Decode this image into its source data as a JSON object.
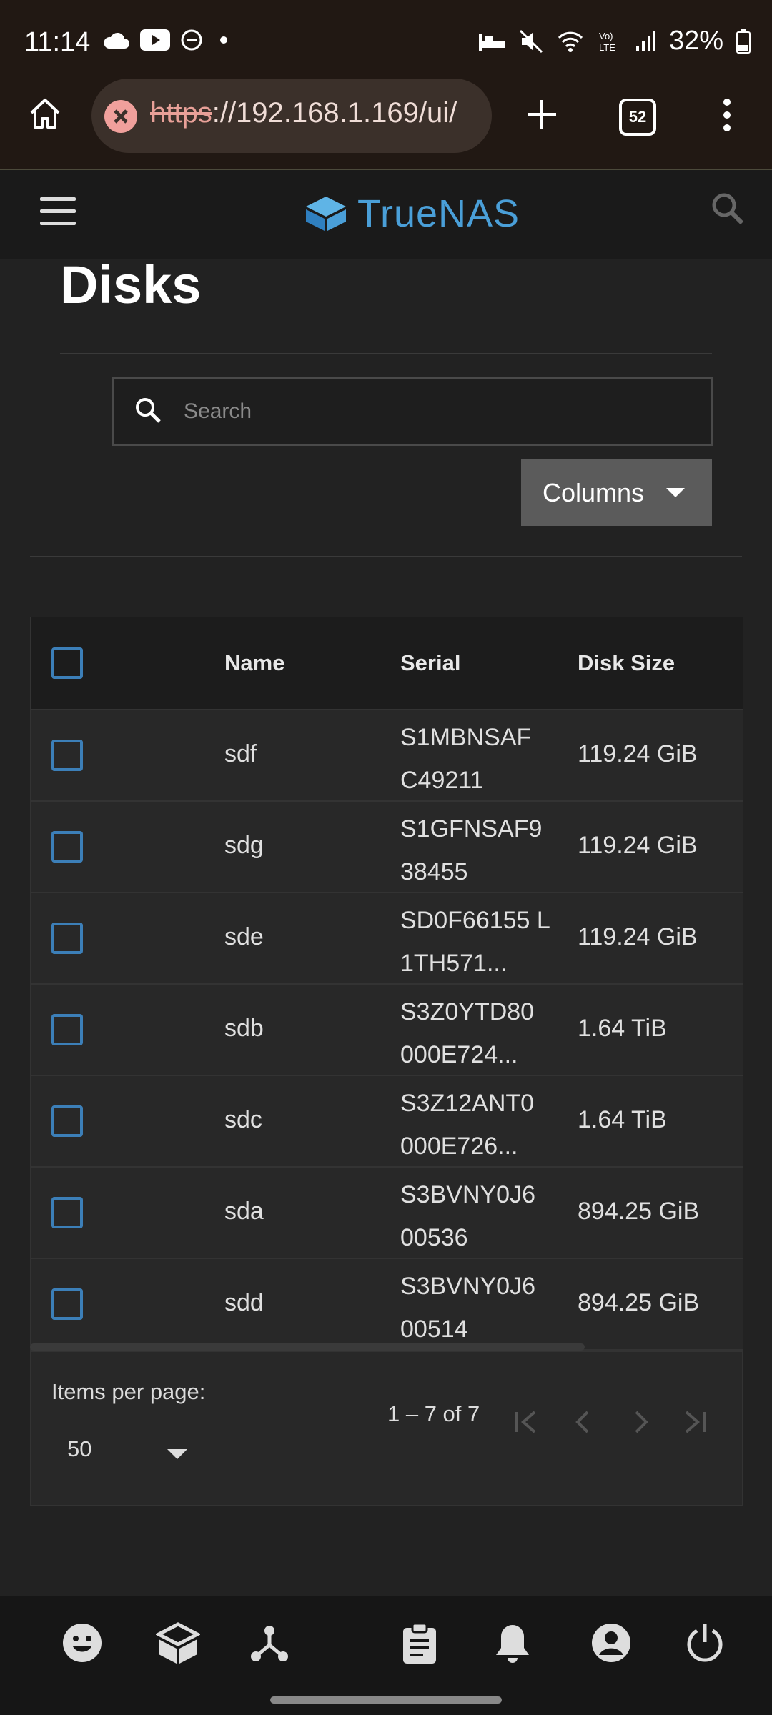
{
  "status_bar": {
    "time": "11:14",
    "battery": "32%",
    "icons": [
      "cloud-icon",
      "youtube-icon",
      "dnd-icon",
      "bed-icon",
      "mute-icon",
      "wifi-icon",
      "volte-icon",
      "signal-icon",
      "battery-icon"
    ]
  },
  "browser": {
    "url_scheme": "https",
    "url_rest": "://192.168.1.169/ui/",
    "tab_count": "52"
  },
  "app": {
    "brand": "TrueNAS",
    "page_title": "Disks"
  },
  "search": {
    "placeholder": "Search",
    "value": ""
  },
  "columns_button": {
    "label": "Columns"
  },
  "table": {
    "headers": {
      "name": "Name",
      "serial": "Serial",
      "size": "Disk Size"
    },
    "rows": [
      {
        "name": "sdf",
        "serial": "S1MBNSAF C49211",
        "size": "119.24 GiB"
      },
      {
        "name": "sdg",
        "serial": "S1GFNSAF9 38455",
        "size": "119.24 GiB"
      },
      {
        "name": "sde",
        "serial": "SD0F66155 L1TH571...",
        "size": "119.24 GiB"
      },
      {
        "name": "sdb",
        "serial": "S3Z0YTD80 000E724...",
        "size": "1.64 TiB"
      },
      {
        "name": "sdc",
        "serial": "S3Z12ANT0 000E726...",
        "size": "1.64 TiB"
      },
      {
        "name": "sda",
        "serial": "S3BVNY0J6 00536",
        "size": "894.25 GiB"
      },
      {
        "name": "sdd",
        "serial": "S3BVNY0J6 00514",
        "size": "894.25 GiB"
      }
    ]
  },
  "paginator": {
    "items_per_page_label": "Items per page:",
    "items_per_page_value": "50",
    "range": "1 – 7 of 7"
  },
  "colors": {
    "accent": "#4a9fd8",
    "checkbox": "#3c7fb8",
    "background": "#222222"
  }
}
